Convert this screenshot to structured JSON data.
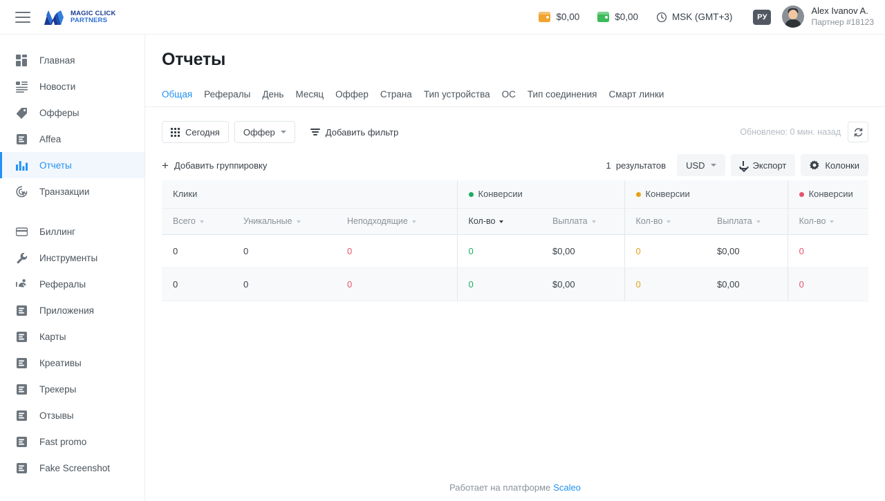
{
  "header": {
    "menu_icon": "hamburger-icon",
    "logo": {
      "line1": "MAGIC CLICK",
      "line2": "PARTNERS"
    },
    "balances": [
      {
        "icon": "wallet-icon",
        "color": "#f0a32e",
        "amount": "$0,00"
      },
      {
        "icon": "wallet-icon",
        "color": "#3cbb5a",
        "amount": "$0,00"
      }
    ],
    "timezone": {
      "icon": "clock-icon",
      "label": "MSK (GMT+3)"
    },
    "language_badge": "РУ",
    "user": {
      "name": "Alex Ivanov A.",
      "role": "Партнер #18123"
    }
  },
  "sidebar": {
    "items": [
      {
        "label": "Главная",
        "icon": "dashboard-icon",
        "active": false
      },
      {
        "label": "Новости",
        "icon": "news-icon",
        "active": false
      },
      {
        "label": "Офферы",
        "icon": "tag-icon",
        "active": false
      },
      {
        "label": "Affea",
        "icon": "document-icon",
        "active": false
      },
      {
        "label": "Отчеты",
        "icon": "bar-chart-icon",
        "active": true
      },
      {
        "label": "Транзакции",
        "icon": "click-icon",
        "active": false
      },
      {
        "label": "Биллинг",
        "icon": "credit-card-icon",
        "active": false,
        "gap_before": true
      },
      {
        "label": "Инструменты",
        "icon": "wrench-icon",
        "active": false
      },
      {
        "label": "Рефералы",
        "icon": "referral-icon",
        "active": false
      },
      {
        "label": "Приложения",
        "icon": "document-icon",
        "active": false
      },
      {
        "label": "Карты",
        "icon": "document-icon",
        "active": false
      },
      {
        "label": "Креативы",
        "icon": "document-icon",
        "active": false
      },
      {
        "label": "Трекеры",
        "icon": "document-icon",
        "active": false
      },
      {
        "label": "Отзывы",
        "icon": "document-icon",
        "active": false
      },
      {
        "label": "Fast promo",
        "icon": "document-icon",
        "active": false
      },
      {
        "label": "Fake Screenshot",
        "icon": "document-icon",
        "active": false
      }
    ]
  },
  "main": {
    "title": "Отчеты",
    "tabs": [
      {
        "label": "Общая",
        "active": true
      },
      {
        "label": "Рефералы",
        "active": false
      },
      {
        "label": "День",
        "active": false
      },
      {
        "label": "Месяц",
        "active": false
      },
      {
        "label": "Оффер",
        "active": false
      },
      {
        "label": "Страна",
        "active": false
      },
      {
        "label": "Тип устройства",
        "active": false
      },
      {
        "label": "ОС",
        "active": false
      },
      {
        "label": "Тип соединения",
        "active": false
      },
      {
        "label": "Смарт линки",
        "active": false
      }
    ],
    "filterbar": {
      "date_button": {
        "label": "Сегодня",
        "icon": "grid-icon"
      },
      "offer_select": {
        "label": "Оффер",
        "icon": "chevron-down-icon"
      },
      "add_filter": {
        "label": "Добавить фильтр",
        "icon": "filter-icon"
      },
      "updated_label": "Обновлено: 0 мин. назад",
      "refresh_icon": "refresh-icon"
    },
    "groupbar": {
      "add_grouping": {
        "label": "Добавить группировку",
        "icon": "plus-icon"
      },
      "results_count": "1",
      "results_label": "результатов",
      "currency": "USD",
      "export": {
        "label": "Экспорт",
        "icon": "download-icon"
      },
      "columns": {
        "label": "Колонки",
        "icon": "gear-icon"
      }
    }
  },
  "table": {
    "groups": [
      {
        "label": "Клики",
        "dot": null,
        "span": 3
      },
      {
        "label": "Конверсии",
        "dot": "#1eab62",
        "span": 2
      },
      {
        "label": "Конверсии",
        "dot": "#e6a117",
        "span": 2
      },
      {
        "label": "Конверсии",
        "dot": "#e8536c",
        "span": 1
      }
    ],
    "columns": [
      {
        "label": "Всего",
        "sorted": false,
        "sep": false
      },
      {
        "label": "Уникальные",
        "sorted": false,
        "sep": false
      },
      {
        "label": "Неподходящие",
        "sorted": false,
        "sep": false
      },
      {
        "label": "Кол-во",
        "sorted": true,
        "sep": true
      },
      {
        "label": "Выплата",
        "sorted": false,
        "sep": false
      },
      {
        "label": "Кол-во",
        "sorted": false,
        "sep": true
      },
      {
        "label": "Выплата",
        "sorted": false,
        "sep": false
      },
      {
        "label": "Кол-во",
        "sorted": false,
        "sep": true
      }
    ],
    "rows": [
      {
        "alt": false,
        "cells": [
          {
            "value": "0",
            "color": ""
          },
          {
            "value": "0",
            "color": ""
          },
          {
            "value": "0",
            "color": "c-red"
          },
          {
            "value": "0",
            "color": "c-green",
            "sep": true
          },
          {
            "value": "$0,00",
            "color": ""
          },
          {
            "value": "0",
            "color": "c-orange",
            "sep": true
          },
          {
            "value": "$0,00",
            "color": ""
          },
          {
            "value": "0",
            "color": "c-red",
            "sep": true
          }
        ]
      },
      {
        "alt": true,
        "cells": [
          {
            "value": "0",
            "color": ""
          },
          {
            "value": "0",
            "color": ""
          },
          {
            "value": "0",
            "color": "c-red"
          },
          {
            "value": "0",
            "color": "c-green",
            "sep": true
          },
          {
            "value": "$0,00",
            "color": ""
          },
          {
            "value": "0",
            "color": "c-orange",
            "sep": true
          },
          {
            "value": "$0,00",
            "color": ""
          },
          {
            "value": "0",
            "color": "c-red",
            "sep": true
          }
        ]
      }
    ]
  },
  "footer": {
    "text": "Работает на платформе",
    "link": "Scaleo"
  }
}
